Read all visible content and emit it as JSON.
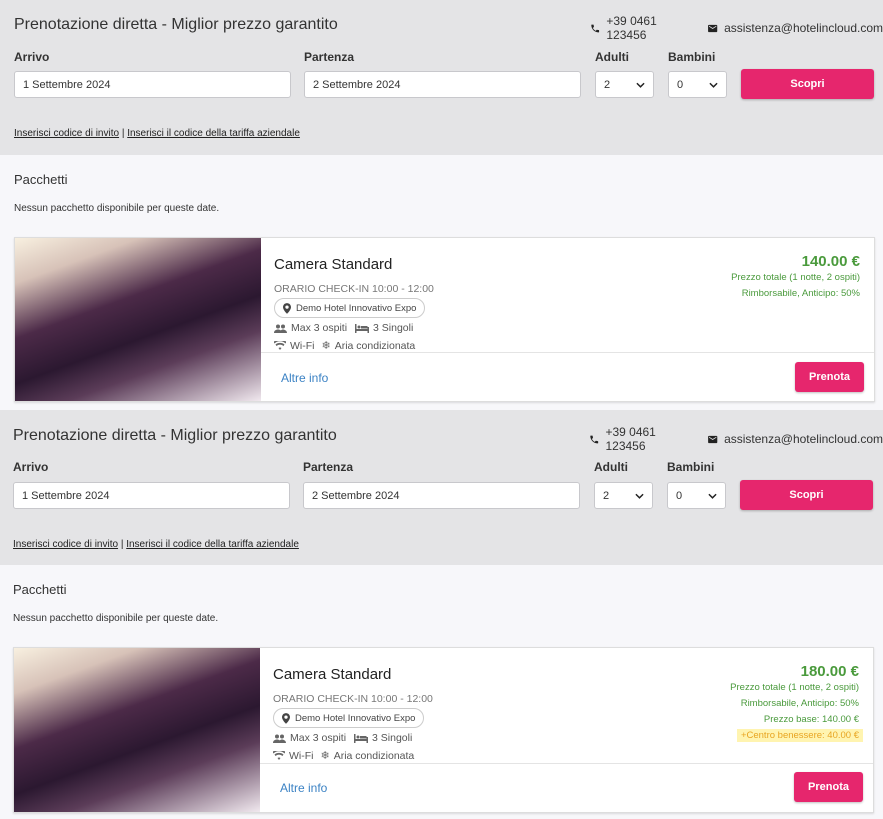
{
  "blocks": [
    {
      "header": {
        "title": "Prenotazione diretta - Miglior prezzo garantito",
        "phone": "+39 0461 123456",
        "email": "assistenza@hotelincloud.com"
      },
      "form": {
        "arrivo_label": "Arrivo",
        "arrivo_value": "1 Settembre 2024",
        "partenza_label": "Partenza",
        "partenza_value": "2 Settembre 2024",
        "adulti_label": "Adulti",
        "adulti_value": "2",
        "bambini_label": "Bambini",
        "bambini_value": "0",
        "scopri_label": "Scopri"
      },
      "links": {
        "invito": "Inserisci codice di invito",
        "separator": "|",
        "aziendale": "Inserisci il codice della tariffa aziendale"
      },
      "pacchetti": {
        "title": "Pacchetti",
        "note": "Nessun pacchetto disponibile per queste date."
      },
      "room": {
        "name": "Camera Standard",
        "checkin": "ORARIO CHECK-IN 10:00 - 12:00",
        "hotel": "Demo Hotel Innovativo Expo",
        "guests": "Max 3 ospiti",
        "beds": "3 Singoli",
        "wifi": "Wi-Fi",
        "ac": "Aria condizionata",
        "altre_info": "Altre info",
        "prenota": "Prenota",
        "price": "140.00 €",
        "price_info1": "Prezzo totale (1 notte, 2 ospiti)",
        "price_info2": "Rimborsabile, Anticipo: 50%"
      }
    },
    {
      "header": {
        "title": "Prenotazione diretta - Miglior prezzo garantito",
        "phone": "+39 0461 123456",
        "email": "assistenza@hotelincloud.com"
      },
      "form": {
        "arrivo_label": "Arrivo",
        "arrivo_value": "1 Settembre 2024",
        "partenza_label": "Partenza",
        "partenza_value": "2 Settembre 2024",
        "adulti_label": "Adulti",
        "adulti_value": "2",
        "bambini_label": "Bambini",
        "bambini_value": "0",
        "scopri_label": "Scopri"
      },
      "links": {
        "invito": "Inserisci codice di invito",
        "separator": "|",
        "aziendale": "Inserisci il codice della tariffa aziendale"
      },
      "pacchetti": {
        "title": "Pacchetti",
        "note": "Nessun pacchetto disponibile per queste date."
      },
      "room": {
        "name": "Camera Standard",
        "checkin": "ORARIO CHECK-IN 10:00 - 12:00",
        "hotel": "Demo Hotel Innovativo Expo",
        "guests": "Max 3 ospiti",
        "beds": "3 Singoli",
        "wifi": "Wi-Fi",
        "ac": "Aria condizionata",
        "altre_info": "Altre info",
        "prenota": "Prenota",
        "price": "180.00 €",
        "price_info1": "Prezzo totale (1 notte, 2 ospiti)",
        "price_info2": "Rimborsabile, Anticipo: 50%",
        "prezzo_base": "Prezzo base: 140.00 €",
        "extra": "+Centro benessere: 40.00 €"
      }
    }
  ],
  "colors": {
    "accent": "#e6266d",
    "price_green": "#4a9a3c",
    "link_blue": "#3b82c4",
    "highlight": "#fff4b0"
  }
}
